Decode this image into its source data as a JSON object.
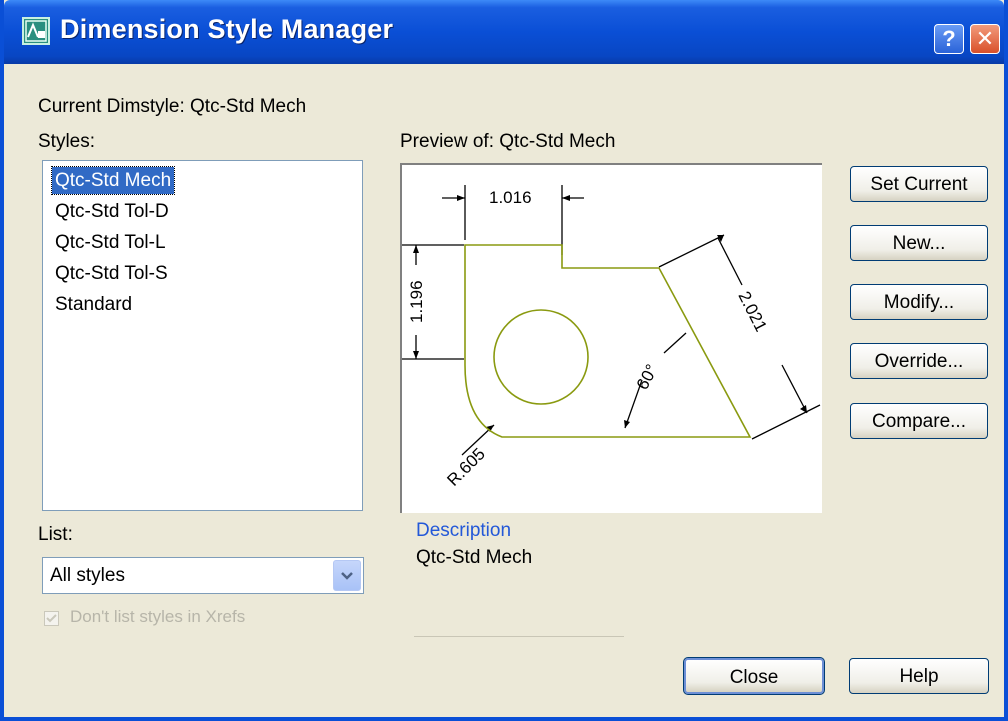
{
  "window": {
    "title": "Dimension Style Manager",
    "help_glyph": "?",
    "close_glyph": "✕"
  },
  "current_dimstyle": "Current Dimstyle: Qtc-Std Mech",
  "styles_label": "Styles:",
  "styles": [
    {
      "label": "Qtc-Std Mech",
      "selected": true
    },
    {
      "label": "Qtc-Std Tol-D",
      "selected": false
    },
    {
      "label": "Qtc-Std Tol-L",
      "selected": false
    },
    {
      "label": "Qtc-Std Tol-S",
      "selected": false
    },
    {
      "label": "Standard",
      "selected": false
    }
  ],
  "list_label": "List:",
  "list_value": "All styles",
  "xref_checkbox_label": "Don't list styles in Xrefs",
  "preview_label": "Preview of: Qtc-Std Mech",
  "preview_dims": {
    "horizontal": "1.016",
    "vertical": "1.196",
    "aligned": "2.021",
    "angle": "60°",
    "radius": "R.605"
  },
  "description_title": "Description",
  "description_text": "Qtc-Std Mech",
  "buttons": {
    "set_current": "Set Current",
    "new": "New...",
    "modify": "Modify...",
    "override": "Override...",
    "compare": "Compare...",
    "close": "Close",
    "help": "Help"
  },
  "colors": {
    "title_bar": "#0a4fd6",
    "selection": "#316ac5",
    "geometry": "#8a9a10",
    "description": "#2358d8"
  }
}
